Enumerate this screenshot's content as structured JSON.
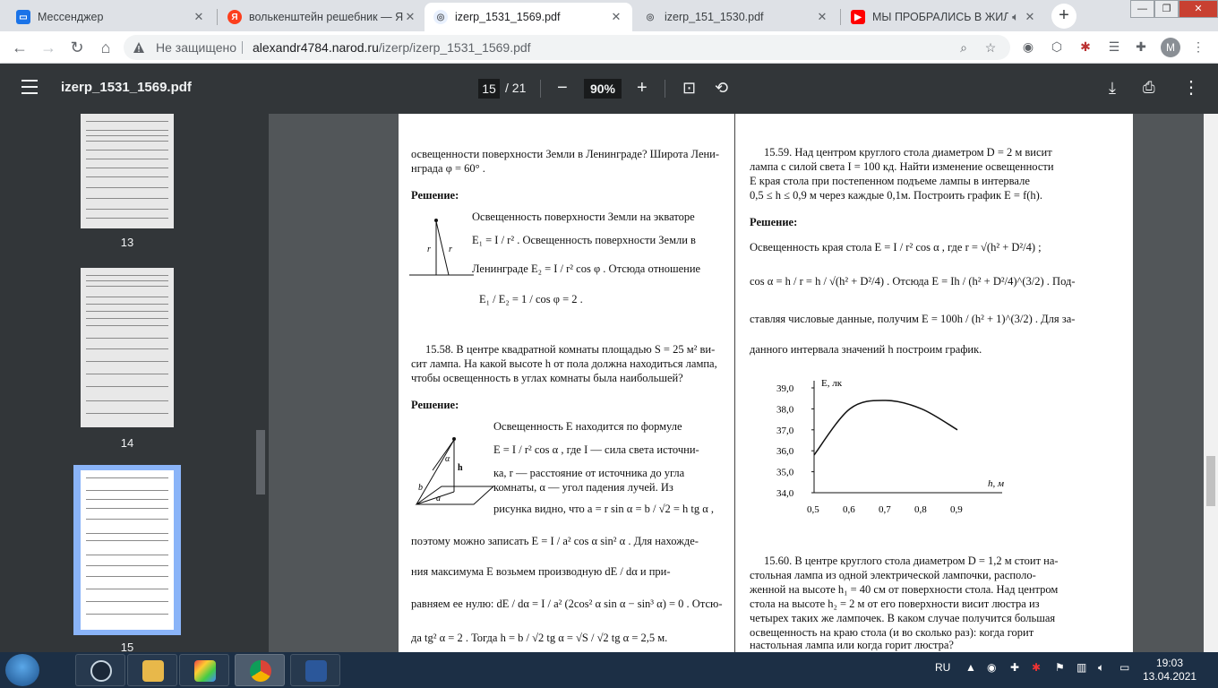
{
  "tabs": [
    {
      "title": "Мессенджер",
      "favicon_color": "#1a73e8"
    },
    {
      "title": "волькенштейн решебник — Я",
      "favicon_color": "#fc3f1d"
    },
    {
      "title": "izerp_1531_1569.pdf",
      "favicon_color": "#5f6368"
    },
    {
      "title": "izerp_151_1530.pdf",
      "favicon_color": "#5f6368"
    },
    {
      "title": "МЫ ПРОБРАЛИСЬ В ЖИЛ",
      "favicon_color": "#ff0000"
    }
  ],
  "toolbar": {
    "security": "Не защищено",
    "url_host": "alexandr4784.narod.ru",
    "url_path": "/izerp/izerp_1531_1569.pdf",
    "avatar": "M"
  },
  "pdf": {
    "filename": "izerp_1531_1569.pdf",
    "current_page": "15",
    "total_pages": "/ 21",
    "zoom": "90%"
  },
  "thumbnails": [
    {
      "label": "13"
    },
    {
      "label": "14"
    },
    {
      "label": "15"
    }
  ],
  "page": {
    "l1": "освещенности поверхности Земли в Ленинграде? Широта Лени-",
    "l2": "нграда  φ = 60° .",
    "sol1": "Решение:",
    "p1a": "Освещенность поверхности Земли на экваторе",
    "p1b": "E₁ = I / r² .  Освещенность поверхности Земли в",
    "p1c": "Ленинграде  E₂ = I / r² cos φ .  Отсюда отношение",
    "p1d": "E₁ / E₂ = 1 / cos φ = 2 .",
    "p58a": "15.58.  В центре квадратной комнаты площадью  S = 25 м²  ви-",
    "p58b": "сит лампа. На какой высоте  h  от пола должна находиться лампа,",
    "p58c": "чтобы освещенность в углах комнаты была наибольшей?",
    "sol2": "Решение:",
    "q1": "Освещенность  E  находится по формуле",
    "q2": "E = I / r² cos α ,  где  I  — сила света источни-",
    "q3": "ка,   r   — расстояние от источника до угла",
    "q4": "комнаты,   α   — угол падения лучей.  Из",
    "q5": "рисунка видно, что  a = r sin α = b / √2 = h tg α ,",
    "q6": "поэтому можно записать  E = I / a² cos α sin² α .  Для нахожде-",
    "q7": "ния  максимума  E  возьмем производную  dE / dα  и  при-",
    "q8": "равняем ее нулю:  dE / dα = I / a² (2cos² α sin α − sin³ α) = 0 .  Отсю-",
    "q9": "да  tg² α = 2 .  Тогда  h = b / √2 tg α = √S / √2 tg α = 2,5 м.",
    "p59a": "15.59.  Над центром круглого стола диаметром   D = 2 м  висит",
    "p59b": "лампа с силой света   I = 100 кд.  Найти изменение освещенности",
    "p59c": "E   края стола при постепенном подъеме лампы в интервале",
    "p59d": "0,5 ≤ h ≤ 0,9 м через каждые 0,1м.  Построить график  E = f(h).",
    "sol3": "Решение:",
    "r1": "Освещенность края стола  E = I / r² cos α ,  где   r = √(h² + D²/4) ;",
    "r2": "cos α = h / r = h / √(h² + D²/4) .  Отсюда   E = Ih / (h² + D²/4)^(3/2) .  Под-",
    "r3": "ставляя числовые данные, получим   E = 100h / (h² + 1)^(3/2) .  Для за-",
    "r4": "данного интервала значений  h  построим график.",
    "p60a": "15.60.  В центре круглого стола диаметром   D = 1,2 м  стоит на-",
    "p60b": "стольная лампа из одной электрической лампочки, располо-",
    "p60c": "женной на высоте   h₁ = 40 см от поверхности стола.  Над центром",
    "p60d": "стола на высоте   h₂ = 2 м  от его поверхности висит люстра из",
    "p60e": "четырех таких же лампочек.  В каком случае получится большая",
    "p60f": "освещенность на краю стола (и во сколько раз): когда горит",
    "p60g": "настольная лампа или когда горит люстра?"
  },
  "chart_data": {
    "type": "line",
    "ylabel": "E, лк",
    "xlabel": "h, м",
    "x": [
      0.5,
      0.6,
      0.7,
      0.8,
      0.9
    ],
    "y": [
      35.8,
      38.0,
      38.4,
      38.0,
      37.0
    ],
    "xticks": [
      "0,5",
      "0,6",
      "0,7",
      "0,8",
      "0,9"
    ],
    "yticks": [
      "34,0",
      "35,0",
      "36,0",
      "37,0",
      "38,0",
      "39,0"
    ],
    "xlim": [
      0.5,
      0.9
    ],
    "ylim": [
      34.0,
      39.0
    ]
  },
  "taskbar": {
    "lang": "RU",
    "time": "19:03",
    "date": "13.04.2021"
  }
}
